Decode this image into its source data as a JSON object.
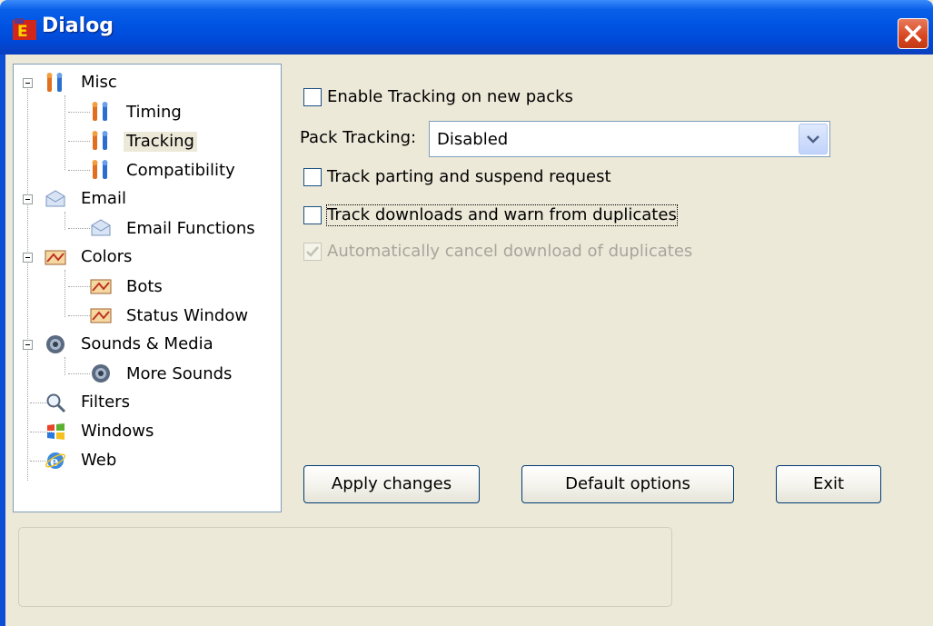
{
  "window": {
    "title": "Dialog"
  },
  "tree": {
    "items": [
      {
        "label": "Misc",
        "icon": "tools-icon"
      },
      {
        "label": "Timing",
        "icon": "tools-icon"
      },
      {
        "label": "Tracking",
        "icon": "tools-icon",
        "selected": true
      },
      {
        "label": "Compatibility",
        "icon": "tools-icon"
      },
      {
        "label": "Email",
        "icon": "email-icon"
      },
      {
        "label": "Email Functions",
        "icon": "email-icon"
      },
      {
        "label": "Colors",
        "icon": "palette-icon"
      },
      {
        "label": "Bots",
        "icon": "palette-icon"
      },
      {
        "label": "Status Window",
        "icon": "palette-icon"
      },
      {
        "label": "Sounds & Media",
        "icon": "speaker-icon"
      },
      {
        "label": "More Sounds",
        "icon": "speaker-icon"
      },
      {
        "label": "Filters",
        "icon": "magnifier-icon"
      },
      {
        "label": "Windows",
        "icon": "windows-flag-icon"
      },
      {
        "label": "Web",
        "icon": "web-browser-icon"
      }
    ]
  },
  "options": {
    "enable_tracking": {
      "label": "Enable Tracking on new packs",
      "checked": false
    },
    "pack_tracking": {
      "label": "Pack Tracking:",
      "value": "Disabled"
    },
    "track_parting": {
      "label": "Track parting and suspend request",
      "checked": false
    },
    "track_downloads": {
      "label": "Track downloads and warn from duplicates",
      "checked": false
    },
    "auto_cancel": {
      "label": "Automatically cancel download of duplicates",
      "checked": true,
      "disabled": true
    }
  },
  "buttons": {
    "apply": "Apply changes",
    "defaults": "Default options",
    "exit": "Exit"
  },
  "colors": {
    "titlebar": "#0054e3",
    "face": "#ece9d8",
    "close": "#d8451f"
  }
}
